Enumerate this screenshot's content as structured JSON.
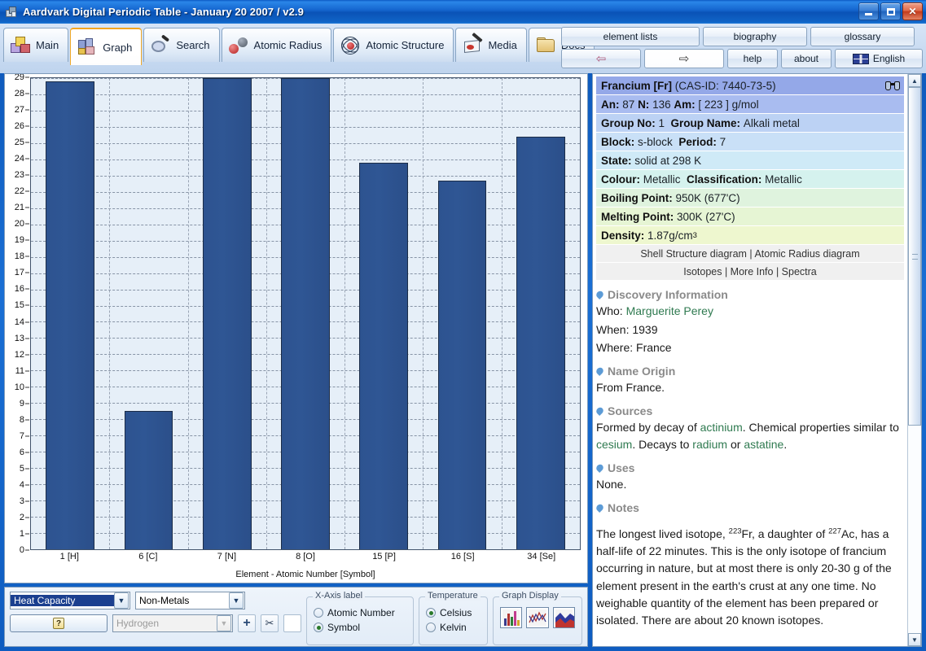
{
  "window": {
    "title": "Aardvark Digital Periodic Table - January 20 2007 / v2.9",
    "minimize": "_",
    "maximize": "□",
    "close": "✕"
  },
  "tabs": [
    {
      "label": "Main",
      "icon": "cubes-icon",
      "active": false
    },
    {
      "label": "Graph",
      "icon": "bar-blocks-icon",
      "active": true
    },
    {
      "label": "Search",
      "icon": "magnifier-icon",
      "active": false
    },
    {
      "label": "Atomic Radius",
      "icon": "two-spheres-icon",
      "active": false
    },
    {
      "label": "Atomic Structure",
      "icon": "atom-icon",
      "active": false
    },
    {
      "label": "Media",
      "icon": "palette-pen-icon",
      "active": false
    },
    {
      "label": "Docs",
      "icon": "folder-icon",
      "active": false
    }
  ],
  "topbuttons": {
    "element_lists": "element lists",
    "biography": "biography",
    "glossary": "glossary",
    "back": "⇦",
    "forward": "⇨",
    "help": "help",
    "about": "about",
    "language": "English"
  },
  "chart_data": {
    "type": "bar",
    "title": "",
    "xlabel": "Element - Atomic Number [Symbol]",
    "ylabel": "",
    "categories": [
      "1 [H]",
      "6 [C]",
      "7 [N]",
      "8 [O]",
      "15 [P]",
      "16 [S]",
      "34 [Se]"
    ],
    "values": [
      28.8,
      8.5,
      29.1,
      29.3,
      23.8,
      22.7,
      25.4
    ],
    "ylim": [
      0,
      29
    ],
    "yticks": [
      0,
      1,
      2,
      3,
      4,
      5,
      6,
      7,
      8,
      9,
      10,
      11,
      12,
      13,
      14,
      15,
      16,
      17,
      18,
      19,
      20,
      21,
      22,
      23,
      24,
      25,
      26,
      27,
      28,
      29
    ],
    "grid": true,
    "legend": "none",
    "series_color": "#2d5390",
    "plot_background": "#e6eff8"
  },
  "controls": {
    "property_value": "Heat Capacity",
    "group_value": "Non-Metals",
    "element_value": "Hydrogen",
    "help_label": "?",
    "add_label": "+",
    "cut_label": "✂",
    "blank_label": "",
    "xaxis": {
      "legend": "X-Axis label",
      "options": [
        "Atomic Number",
        "Symbol"
      ],
      "selected": "Symbol"
    },
    "temperature": {
      "legend": "Temperature",
      "options": [
        "Celsius",
        "Kelvin"
      ],
      "selected": "Celsius"
    },
    "graph_display": {
      "legend": "Graph Display",
      "options": [
        "bar-chart-icon",
        "line-chart-icon",
        "area-chart-icon"
      ]
    }
  },
  "element": {
    "name_line": "Francium [Fr]",
    "cas": "(CAS-ID: 7440-73-5)",
    "an_label": "An:",
    "an_value": "87",
    "n_label": "N:",
    "n_value": "136",
    "am_label": "Am:",
    "am_value": "[ 223 ] g/mol",
    "group_no_label": "Group No:",
    "group_no_value": "1",
    "group_name_label": "Group Name:",
    "group_name_value": "Alkali metal",
    "block_label": "Block:",
    "block_value": "s-block",
    "period_label": "Period:",
    "period_value": "7",
    "state_label": "State:",
    "state_value": "solid at 298 K",
    "colour_label": "Colour:",
    "colour_value": "Metallic",
    "classification_label": "Classification:",
    "classification_value": "Metallic",
    "boiling_label": "Boiling Point:",
    "boiling_value": "950K (677'C)",
    "melting_label": "Melting Point:",
    "melting_value": "300K (27'C)",
    "density_label": "Density:",
    "density_value": "1.87g/cm",
    "density_sup": "3",
    "links_row1": "Shell Structure diagram | Atomic Radius diagram",
    "links_row2": "Isotopes | More Info | Spectra"
  },
  "sections": {
    "discovery_title": "Discovery Information",
    "who_label": "Who:",
    "who_value": "Marguerite Perey",
    "when_label": "When:",
    "when_value": "1939",
    "where_label": "Where:",
    "where_value": "France",
    "name_origin_title": "Name Origin",
    "name_origin_text": "From France.",
    "sources_title": "Sources",
    "sources_a": "Formed by decay of ",
    "sources_link1": "actinium",
    "sources_b": ". Chemical properties similar to ",
    "sources_link2": "cesium",
    "sources_c": ". Decays to ",
    "sources_link3": "radium",
    "sources_d": " or ",
    "sources_link4": "astatine",
    "sources_e": ".",
    "uses_title": "Uses",
    "uses_text": "None.",
    "notes_title": "Notes",
    "notes_a": "The longest lived isotope, ",
    "notes_sup1": "223",
    "notes_b": "Fr, a daughter of ",
    "notes_sup2": "227",
    "notes_link1": "Ac",
    "notes_c": ", has a ",
    "notes_link2": "half-life",
    "notes_d": " of 22 minutes. This is the only ",
    "notes_link3": "isotope",
    "notes_e": " of francium occurring in nature, but at most there is only 20-30 g of the element present in the earth's crust at any one time. No weighable quantity of the element has been prepared or isolated. There are about 20 known isotopes."
  },
  "scrollbar": {
    "up": "▲",
    "down": "▼"
  }
}
